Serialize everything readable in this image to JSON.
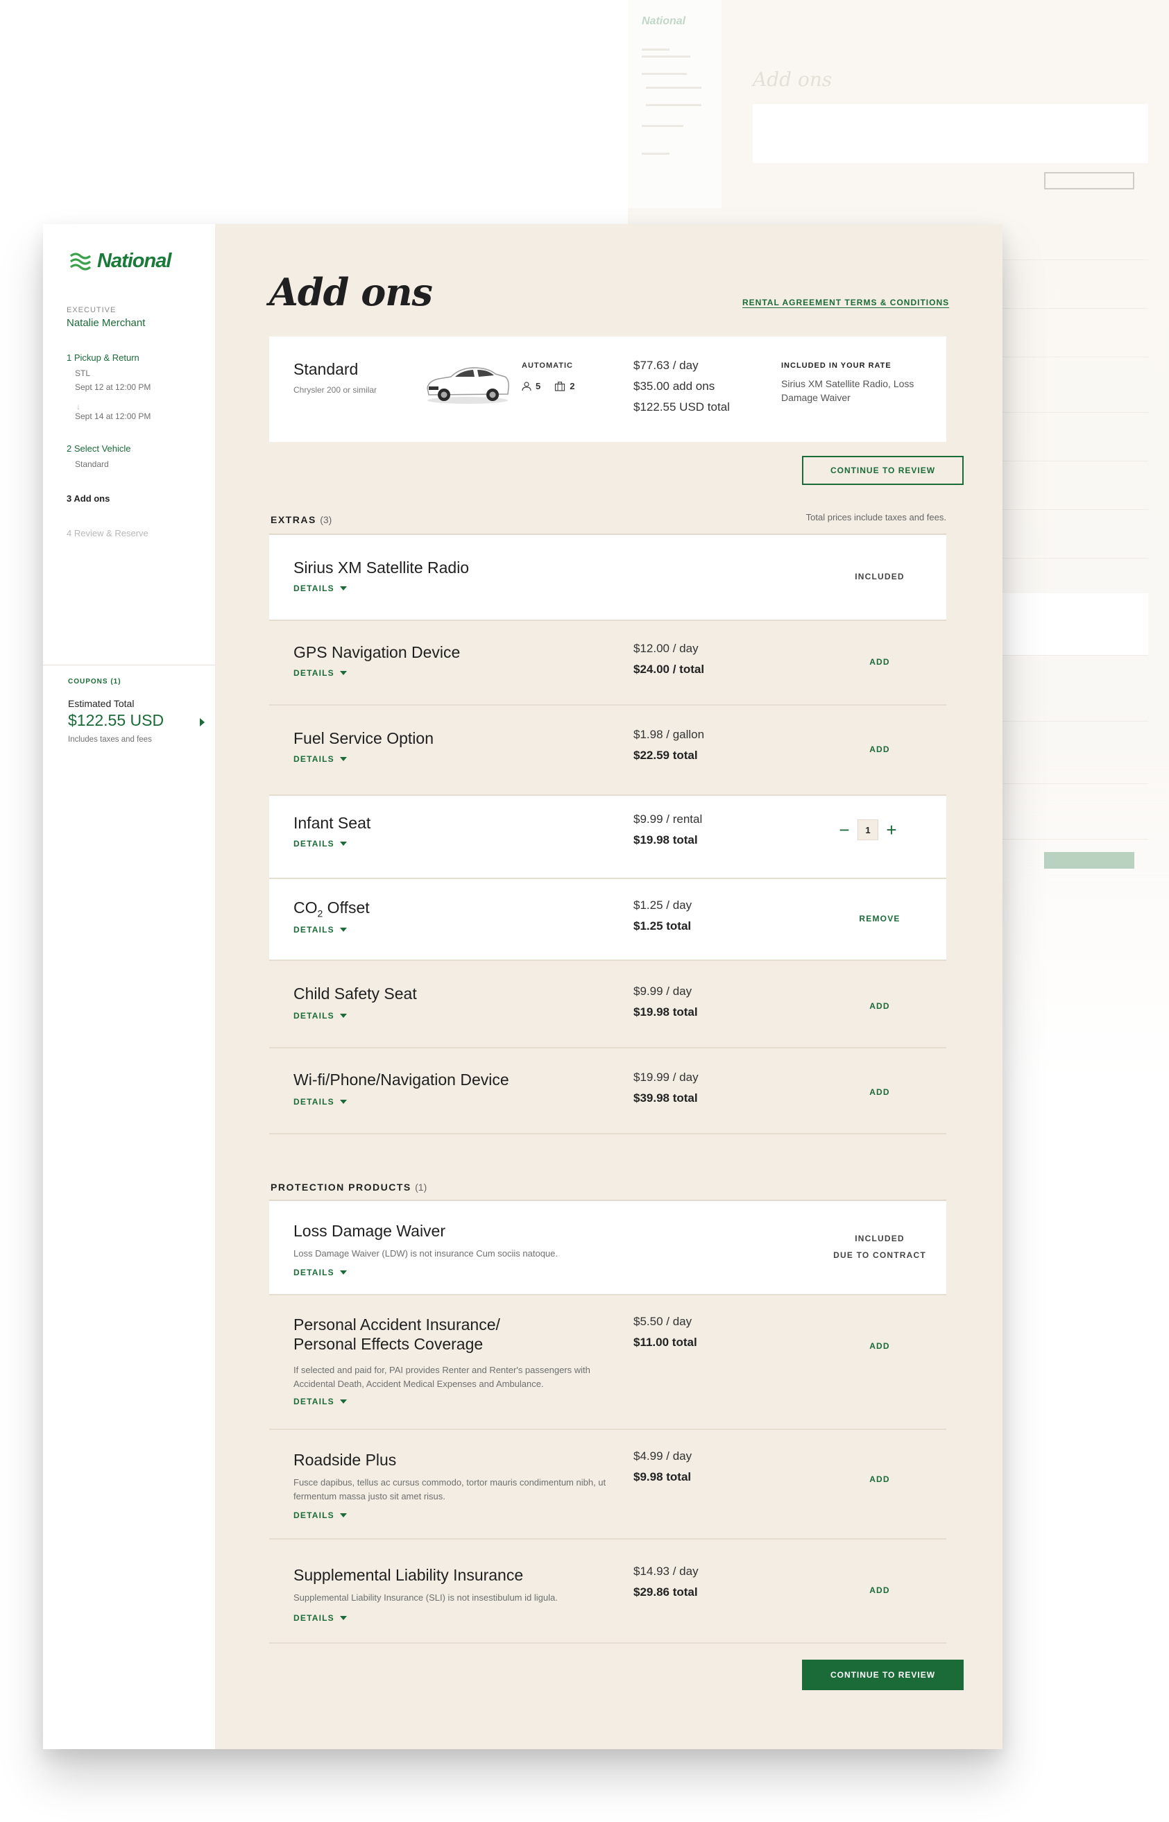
{
  "brand": {
    "logo_text": "National",
    "accent": "#1a6b37",
    "background": "#f3ede3"
  },
  "sidebar": {
    "member_level": "EXECUTIVE",
    "member_name": "Natalie Merchant",
    "steps": [
      {
        "label": "1 Pickup & Return",
        "details": [
          "STL",
          "Sept 12 at 12:00 PM",
          "Sept 14 at 12:00 PM"
        ]
      },
      {
        "label": "2 Select Vehicle",
        "details": [
          "Standard"
        ]
      },
      {
        "label": "3 Add ons",
        "details": []
      },
      {
        "label": "4 Review & Reserve",
        "details": []
      }
    ],
    "arrow_glyph": "↓",
    "coupons_label": "COUPONS (1)",
    "estimated_total_label": "Estimated Total",
    "estimated_total_value": "$122.55 USD",
    "estimated_total_note": "Includes taxes and fees"
  },
  "header": {
    "title": "Add ons",
    "terms_link": "RENTAL AGREEMENT TERMS & CONDITIONS"
  },
  "vehicle": {
    "class": "Standard",
    "model": "Chrysler 200 or similar",
    "transmission": "AUTOMATIC",
    "passengers": "5",
    "bags": "2",
    "price_per_day": "$77.63 / day",
    "addons_price": "$35.00 add ons",
    "total_price": "$122.55 USD total",
    "included_title": "INCLUDED IN YOUR RATE",
    "included_items": "Sirius XM Satellite Radio, Loss Damage Waiver"
  },
  "continue_button": "CONTINUE TO REVIEW",
  "extras": {
    "title": "EXTRAS",
    "count": "(3)",
    "note": "Total prices include taxes and fees.",
    "details_label": "DETAILS",
    "items": [
      {
        "name": "Sirius XM Satellite Radio",
        "status": "INCLUDED"
      },
      {
        "name": "GPS Navigation Device",
        "price": "$12.00 / day",
        "total": "$24.00 / total",
        "action": "ADD"
      },
      {
        "name": "Fuel Service Option",
        "price": "$1.98 / gallon",
        "total": "$22.59 total",
        "action": "ADD"
      },
      {
        "name": "Infant Seat",
        "price": "$9.99 / rental",
        "total": "$19.98 total",
        "quantity": "1",
        "minus": "−",
        "plus": "+"
      },
      {
        "name_main": "CO",
        "name_sub": "2",
        "name_rest": " Offset",
        "price": "$1.25 / day",
        "total": "$1.25 total",
        "action": "REMOVE"
      },
      {
        "name": "Child Safety Seat",
        "price": "$9.99 / day",
        "total": "$19.98 total",
        "action": "ADD"
      },
      {
        "name": "Wi-fi/Phone/Navigation Device",
        "price": "$19.99 / day",
        "total": "$39.98 total",
        "action": "ADD"
      }
    ]
  },
  "protection": {
    "title": "PROTECTION PRODUCTS",
    "count": "(1)",
    "items": [
      {
        "name": "Loss Damage Waiver",
        "desc": "Loss Damage Waiver (LDW) is not insurance Cum sociis natoque.",
        "status_line1": "INCLUDED",
        "status_line2": "DUE TO CONTRACT"
      },
      {
        "name_line1": "Personal Accident Insurance/",
        "name_line2": "Personal Effects Coverage",
        "desc": "If selected and paid for, PAI provides Renter and Renter's passengers with Accidental Death, Accident Medical Expenses and Ambulance.",
        "price": "$5.50 / day",
        "total": "$11.00 total",
        "action": "ADD"
      },
      {
        "name": "Roadside Plus",
        "desc": "Fusce dapibus, tellus ac cursus commodo, tortor mauris condimentum nibh, ut fermentum massa justo sit amet risus.",
        "price": "$4.99 / day",
        "total": "$9.98 total",
        "action": "ADD"
      },
      {
        "name": "Supplemental Liability Insurance",
        "desc": "Supplemental Liability Insurance (SLI) is not insestibulum id ligula.",
        "price": "$14.93 / day",
        "total": "$29.86 total",
        "action": "ADD"
      }
    ]
  }
}
